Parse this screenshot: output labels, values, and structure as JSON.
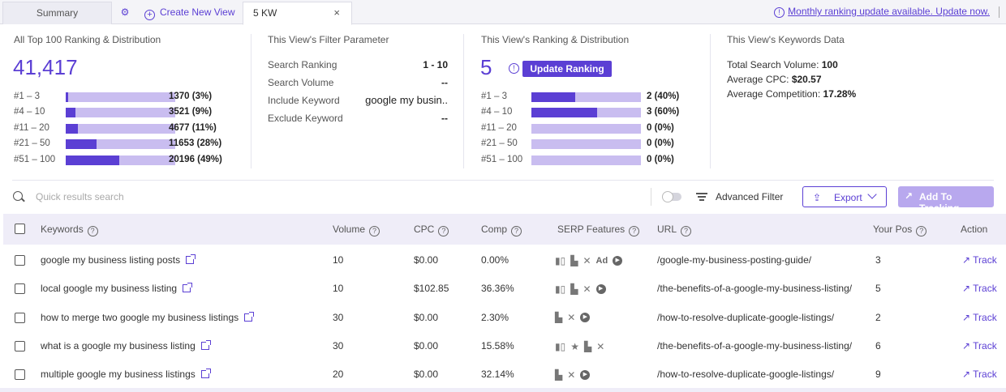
{
  "tabs": {
    "summary": "Summary",
    "create_view": "Create New View",
    "active": "5 KW",
    "close": "×"
  },
  "notice": "Monthly ranking update available. Update now.",
  "panel_all": {
    "title": "All Top 100 Ranking & Distribution",
    "total": "41,417",
    "rows": [
      {
        "label": "#1 – 3",
        "value": "1370 (3%)",
        "fraction": 0.03
      },
      {
        "label": "#4 – 10",
        "value": "3521 (9%)",
        "fraction": 0.09
      },
      {
        "label": "#11 – 20",
        "value": "4677 (11%)",
        "fraction": 0.11
      },
      {
        "label": "#21 – 50",
        "value": "11653 (28%)",
        "fraction": 0.28
      },
      {
        "label": "#51 – 100",
        "value": "20196 (49%)",
        "fraction": 0.49
      }
    ]
  },
  "panel_filter": {
    "title": "This View's Filter Parameter",
    "rows": [
      {
        "key": "Search Ranking",
        "value": "1 - 10"
      },
      {
        "key": "Search Volume",
        "value": "--"
      },
      {
        "key": "Include Keyword",
        "value": "google my busin.."
      },
      {
        "key": "Exclude Keyword",
        "value": "--"
      }
    ]
  },
  "panel_view": {
    "title": "This View's Ranking & Distribution",
    "total": "5",
    "update_button": "Update Ranking",
    "rows": [
      {
        "label": "#1 – 3",
        "value": "2 (40%)",
        "fraction": 0.4
      },
      {
        "label": "#4 – 10",
        "value": "3 (60%)",
        "fraction": 0.6
      },
      {
        "label": "#11 – 20",
        "value": "0 (0%)",
        "fraction": 0
      },
      {
        "label": "#21 – 50",
        "value": "0 (0%)",
        "fraction": 0
      },
      {
        "label": "#51 – 100",
        "value": "0 (0%)",
        "fraction": 0
      }
    ]
  },
  "panel_keywords": {
    "title": "This View's Keywords Data",
    "rows": [
      {
        "key": "Total Search Volume: ",
        "value": "100"
      },
      {
        "key": "Average CPC: ",
        "value": "$20.57"
      },
      {
        "key": "Average Competition: ",
        "value": "17.28%"
      }
    ]
  },
  "toolbar": {
    "search_placeholder": "Quick results search",
    "advanced_filter": "Advanced Filter",
    "export": "Export",
    "add_tracking": "Add To Tracking"
  },
  "table": {
    "headers": {
      "keywords": "Keywords",
      "volume": "Volume",
      "cpc": "CPC",
      "comp": "Comp",
      "serp": "SERP Features",
      "url": "URL",
      "pos": "Your Pos",
      "action": "Action"
    },
    "track_label": "Track",
    "rows": [
      {
        "keyword": "google my business listing posts",
        "volume": "10",
        "cpc": "$0.00",
        "comp": "0.00%",
        "serp": [
          "listing",
          "pin",
          "cross",
          "Ad",
          "play"
        ],
        "url": "/google-my-business-posting-guide/",
        "pos": "3"
      },
      {
        "keyword": "local google my business listing",
        "volume": "10",
        "cpc": "$102.85",
        "comp": "36.36%",
        "serp": [
          "listing",
          "pin",
          "cross",
          "play"
        ],
        "url": "/the-benefits-of-a-google-my-business-listing/",
        "pos": "5"
      },
      {
        "keyword": "how to merge two google my business listings",
        "volume": "30",
        "cpc": "$0.00",
        "comp": "2.30%",
        "serp": [
          "pin",
          "cross",
          "play"
        ],
        "url": "/how-to-resolve-duplicate-google-listings/",
        "pos": "2"
      },
      {
        "keyword": "what is a google my business listing",
        "volume": "30",
        "cpc": "$0.00",
        "comp": "15.58%",
        "serp": [
          "listing",
          "star",
          "pin",
          "cross"
        ],
        "url": "/the-benefits-of-a-google-my-business-listing/",
        "pos": "6"
      },
      {
        "keyword": "multiple google my business listings",
        "volume": "20",
        "cpc": "$0.00",
        "comp": "32.14%",
        "serp": [
          "pin",
          "cross",
          "play"
        ],
        "url": "/how-to-resolve-duplicate-google-listings/",
        "pos": "9"
      }
    ]
  },
  "colors": {
    "accent": "#5b3fd4",
    "bar_track": "#c9bdf0",
    "header_bg": "#efedf8"
  }
}
